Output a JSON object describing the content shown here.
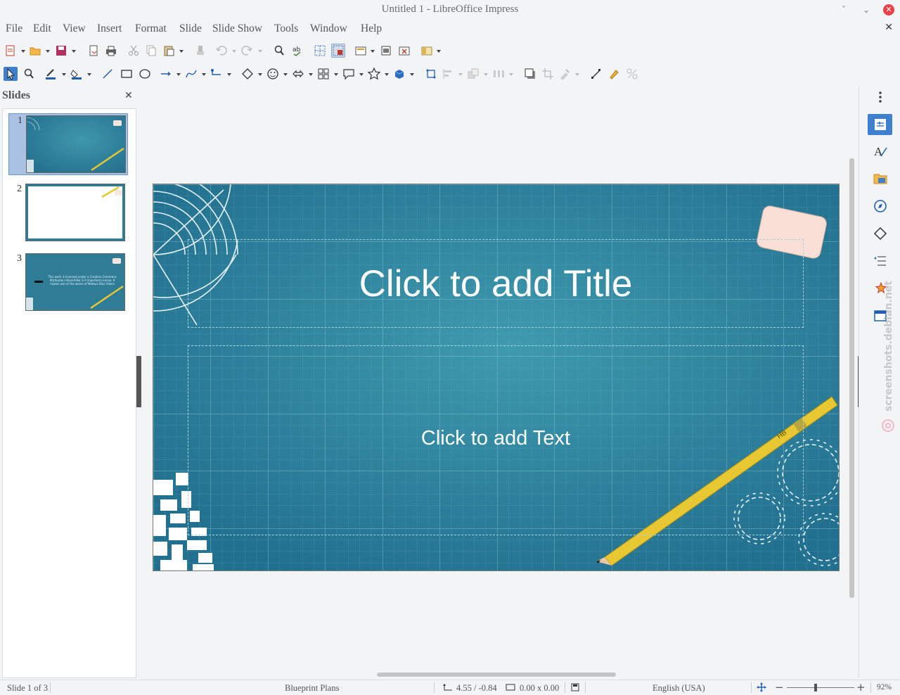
{
  "window": {
    "title": "Untitled 1 - LibreOffice Impress",
    "minimize": "ˇ",
    "restore": "⌄",
    "close": "✕",
    "doc_close": "✕"
  },
  "menu": [
    "File",
    "Edit",
    "View",
    "Insert",
    "Format",
    "Slide",
    "Slide Show",
    "Tools",
    "Window",
    "Help"
  ],
  "slides_pane": {
    "title": "Slides",
    "close": "✕",
    "thumbnails": [
      {
        "number": "1",
        "selected": true
      },
      {
        "number": "2",
        "selected": false
      },
      {
        "number": "3",
        "selected": false,
        "text": "This work is licensed under a Creative Commons Attribution-ShareAlike 3.0 Unported License. It makes use of the works of Mateus Dias Vilaca"
      }
    ]
  },
  "slide": {
    "title_placeholder": "Click to add Title",
    "body_placeholder": "Click to add Text",
    "pencil_label": "HB",
    "background": "#2b7a99",
    "grid_color": "#5fa4bf"
  },
  "status": {
    "slide": "Slide 1 of 3",
    "master": "Blueprint Plans",
    "position": "4.55 / -0.84",
    "size": "0.00 x 0.00",
    "language": "English (USA)",
    "zoom_minus": "−",
    "zoom_plus": "+",
    "zoom": "92%"
  },
  "watermark": "screenshots.debian.net",
  "icons": {
    "toolbar1": [
      "new-icon",
      "open-icon",
      "save-icon",
      "export-pdf-icon",
      "print-icon",
      "cut-icon",
      "copy-icon",
      "paste-icon",
      "clone-formatting-icon",
      "undo-icon",
      "redo-icon",
      "find-replace-icon",
      "spelling-icon",
      "grid-icon",
      "helplines-icon",
      "slide-layout-icon",
      "start-from-first-icon",
      "delete-slide-icon",
      "display-views-icon"
    ],
    "toolbar2": [
      "select-icon",
      "zoom-icon",
      "line-color-icon",
      "fill-color-icon",
      "line-icon",
      "rectangle-icon",
      "ellipse-icon",
      "arrow-icon",
      "curve-icon",
      "connector-icon",
      "basic-shapes-icon",
      "symbol-shapes-icon",
      "block-arrows-icon",
      "flowchart-icon",
      "callouts-icon",
      "stars-icon",
      "3d-objects-icon",
      "rotate-icon",
      "align-icon",
      "arrange-icon",
      "distribute-icon",
      "shadow-icon",
      "crop-icon",
      "filter-icon",
      "points-icon",
      "glue-points-icon",
      "toggle-extrusion-icon"
    ],
    "sidebar": [
      "more-options-icon",
      "properties-icon",
      "styles-icon",
      "gallery-icon",
      "navigator-icon",
      "shapes-icon",
      "slide-transition-icon",
      "animation-icon",
      "master-slides-icon"
    ]
  }
}
